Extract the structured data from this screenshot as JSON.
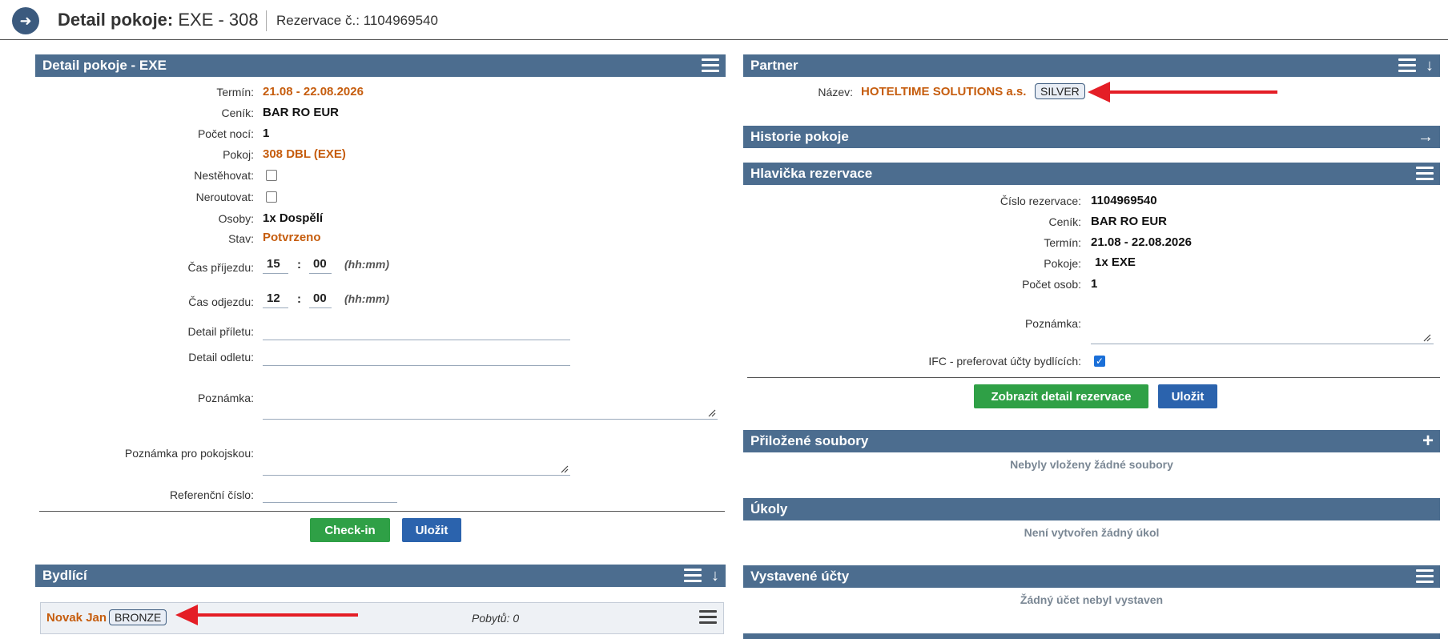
{
  "header": {
    "title_bold": "Detail pokoje:",
    "title_rest": " EXE - 308",
    "reservation": "Rezervace č.: 1104969540"
  },
  "room_panel": {
    "title": "Detail pokoje - EXE",
    "term_label": "Termín:",
    "term_value": "21.08 - 22.08.2026",
    "pricelist_label": "Ceník:",
    "pricelist_value": "BAR RO EUR",
    "nights_label": "Počet nocí:",
    "nights_value": "1",
    "room_label": "Pokoj:",
    "room_value": "308 DBL (EXE)",
    "no_move_label": "Nestěhovat:",
    "no_route_label": "Neroutovat:",
    "persons_label": "Osoby:",
    "persons_value": "1x Dospělí",
    "state_label": "Stav:",
    "state_value": "Potvrzeno",
    "arrival_label": "Čas příjezdu:",
    "arrival_h": "15",
    "arrival_m": "00",
    "departure_label": "Čas odjezdu:",
    "departure_h": "12",
    "departure_m": "00",
    "time_hint": "(hh:mm)",
    "colon": ":",
    "flight_in_label": "Detail příletu:",
    "flight_out_label": "Detail odletu:",
    "note_label": "Poznámka:",
    "housekeeping_note_label": "Poznámka pro pokojskou:",
    "reference_label": "Referenční číslo:",
    "checkin_button": "Check-in",
    "save_button": "Uložit"
  },
  "occupants_panel": {
    "title": "Bydlící",
    "name": "Novak Jan",
    "badge": "BRONZE",
    "stays": "Pobytů: 0"
  },
  "partner_panel": {
    "title": "Partner",
    "name_label": "Název:",
    "name_value": "HOTELTIME SOLUTIONS a.s.",
    "badge": "SILVER"
  },
  "history_panel": {
    "title": "Historie pokoje"
  },
  "reservation_panel": {
    "title": "Hlavička rezervace",
    "number_label": "Číslo rezervace:",
    "number_value": "1104969540",
    "pricelist_label": "Ceník:",
    "pricelist_value": "BAR RO EUR",
    "term_label": "Termín:",
    "term_value": "21.08 - 22.08.2026",
    "rooms_label": "Pokoje:",
    "rooms_value": "1x EXE",
    "persons_label": "Počet osob:",
    "persons_value": "1",
    "note_label": "Poznámka:",
    "ifc_label": "IFC - preferovat účty bydlících:",
    "detail_button": "Zobrazit detail rezervace",
    "save_button": "Uložit"
  },
  "files_panel": {
    "title": "Přiložené soubory",
    "empty": "Nebyly vloženy žádné soubory"
  },
  "tasks_panel": {
    "title": "Úkoly",
    "empty": "Není vytvořen žádný úkol"
  },
  "invoices_panel": {
    "title": "Vystavené účty",
    "empty": "Žádný účet nebyl vystaven"
  },
  "colors": {
    "panel_header": "#4c6d8f",
    "accent_orange": "#c65d0e",
    "green": "#2fa046",
    "blue": "#2b63ad",
    "annotation_red": "#e41e26"
  },
  "icons": {
    "nav": "arrow-right-circle-icon",
    "menu": "hamburger-icon",
    "download": "arrow-down-icon",
    "add": "plus-icon"
  }
}
